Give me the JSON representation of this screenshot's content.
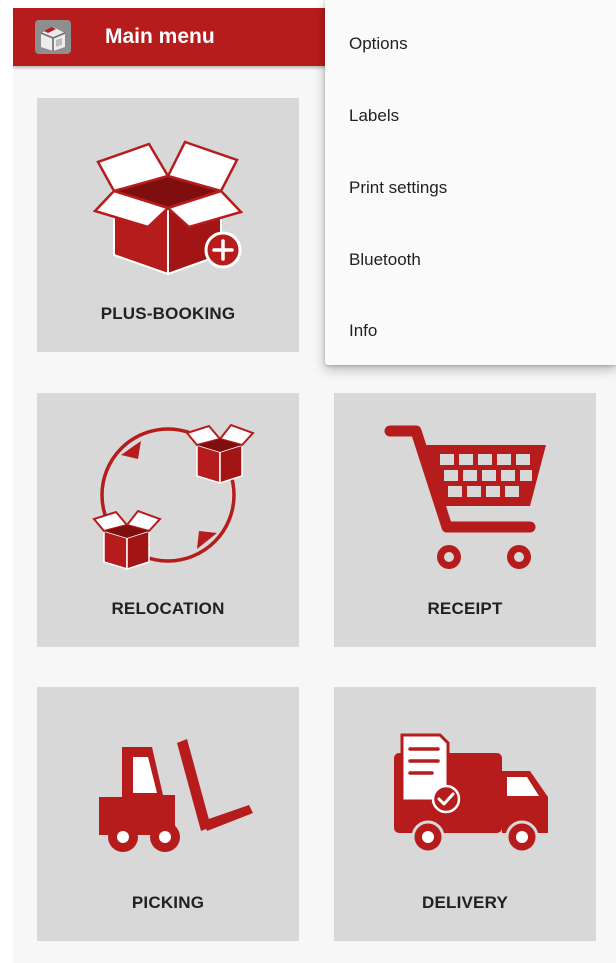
{
  "appbar": {
    "title": "Main menu",
    "logo_icon": "warehouse-box-icon",
    "color": "#b71c1c"
  },
  "tiles": [
    {
      "id": "plus-booking",
      "label": "PLUS-BOOKING",
      "icon": "open-box-plus-icon"
    },
    {
      "id": "relocation",
      "label": "RELOCATION",
      "icon": "relocation-cycle-icon"
    },
    {
      "id": "receipt",
      "label": "RECEIPT",
      "icon": "shopping-cart-icon"
    },
    {
      "id": "picking",
      "label": "PICKING",
      "icon": "forklift-icon"
    },
    {
      "id": "delivery",
      "label": "DELIVERY",
      "icon": "delivery-truck-icon"
    }
  ],
  "overflow_menu": {
    "items": [
      {
        "label": "Options"
      },
      {
        "label": "Labels"
      },
      {
        "label": "Print settings"
      },
      {
        "label": "Bluetooth"
      },
      {
        "label": "Info"
      }
    ]
  },
  "colors": {
    "accent": "#b71c1c",
    "tile_bg": "#d8d8d8",
    "page_bg": "#f7f7f7"
  }
}
